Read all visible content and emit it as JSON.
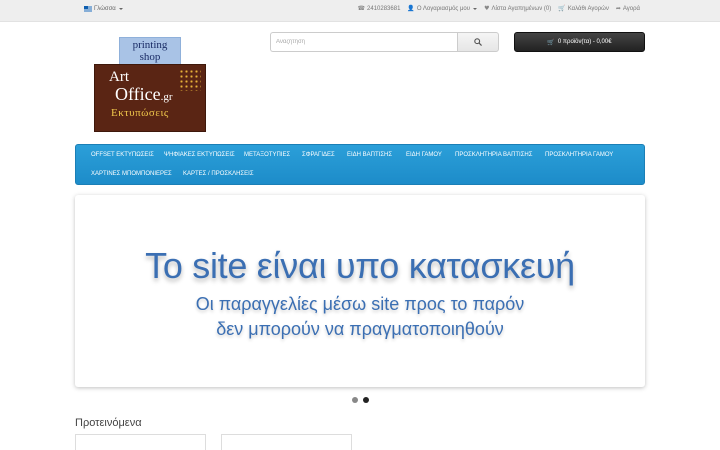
{
  "topbar": {
    "language_label": "Γλώσσα",
    "phone": "2410283681",
    "account": "Ο Λογαριασμός μου",
    "wishlist": "Λίστα Αγαπημένων (0)",
    "cart_link": "Καλάθι Αγορών",
    "checkout": "Αγορά"
  },
  "logo": {
    "line1": "printing",
    "line2": "shop",
    "art": "Art",
    "office": "Office",
    "gr": ".gr",
    "subtitle": "Εκτυπώσεις"
  },
  "search": {
    "placeholder": "Αναζήτηση"
  },
  "cart": {
    "summary": "0 προϊόν(τα) - 0,00€"
  },
  "nav": {
    "items": [
      "OFFSET ΕΚΤΥΠΩΣΕΙΣ",
      "ΨΗΦΙΑΚΕΣ ΕΚΤΥΠΩΣΕΙΣ",
      "ΜΕΤΑΞΟΤΥΠΙΕΣ",
      "ΣΦΡΑΓΙΔΕΣ",
      "ΕΙΔΗ ΒΑΠΤΙΣΗΣ",
      "ΕΙΔΗ ΓΑΜΟΥ",
      "ΠΡΟΣΚΛΗΤΗΡΙΑ ΒΑΠΤΙΣΗΣ",
      "ΠΡΟΣΚΛΗΤΗΡΙΑ ΓΑΜΟΥ",
      "ΧΑΡΤΙΝΕΣ ΜΠΟΜΠΟΝΙΕΡΕΣ",
      "ΚΑΡΤΕΣ / ΠΡΟΣΚΛΗΣΕΙΣ"
    ]
  },
  "slider": {
    "headline": "Το site είναι υπο κατασκευή",
    "line2": "Οι παραγγελίες μέσω site προς το παρόν",
    "line3": "δεν μπορούν να πραγματοποιηθούν",
    "active_slide": 2,
    "slide_count": 2
  },
  "featured": {
    "title": "Προτεινόμενα"
  },
  "colors": {
    "nav_blue": "#2196d3",
    "slide_text": "#3b6fb3",
    "logo_brown": "#5a2514",
    "logo_gold": "#f2c94c"
  }
}
